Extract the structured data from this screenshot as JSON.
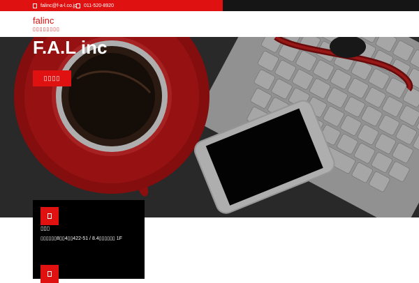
{
  "topbar": {
    "email": "falinc@f-a-l.co.jp",
    "phone": "011-520-8920",
    "accent": "#df1111"
  },
  "header": {
    "brand": "falinc",
    "tagline": "▯▯▯▯▯▯▯▯"
  },
  "hero": {
    "title": "F.A.L inc",
    "button_label": "▯▯▯▯"
  },
  "info": {
    "heading": "▯▯▯",
    "address": "▯▯▯▯▯▯8▯▯4▯▯422-51 / 8.4▯▯▯▯▯▯ 1F"
  },
  "icons": [
    "envelope-icon",
    "phone-icon",
    "map-pin-icon",
    "clock-icon"
  ]
}
